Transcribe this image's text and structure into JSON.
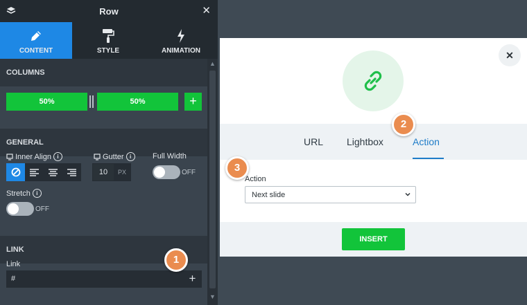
{
  "panel": {
    "title": "Row",
    "close_glyph": "✕",
    "tabs": [
      {
        "label": "CONTENT",
        "icon": "pencil-icon",
        "active": true
      },
      {
        "label": "STYLE",
        "icon": "paint-roller-icon",
        "active": false
      },
      {
        "label": "ANIMATION",
        "icon": "lightning-icon",
        "active": false
      }
    ],
    "sections": {
      "columns": "COLUMNS",
      "general": "GENERAL",
      "link": "LINK"
    },
    "columns": {
      "left": "50%",
      "right": "50%",
      "add": "+"
    },
    "general": {
      "inner_align_label": "Inner Align",
      "gutter_label": "Gutter",
      "gutter_value": "10",
      "gutter_unit": "PX",
      "full_width_label": "Full Width",
      "full_width_state": "OFF",
      "stretch_label": "Stretch",
      "stretch_state": "OFF"
    },
    "link": {
      "label": "Link",
      "value": "#",
      "add": "+"
    }
  },
  "steps": [
    "1",
    "2",
    "3"
  ],
  "modal": {
    "close_glyph": "✕",
    "tabs": [
      {
        "label": "URL",
        "active": false
      },
      {
        "label": "Lightbox",
        "active": false
      },
      {
        "label": "Action",
        "active": true
      }
    ],
    "action_label": "Action",
    "action_value": "Next slide",
    "insert_label": "INSERT"
  },
  "colors": {
    "accent_blue": "#1e88e5",
    "green": "#12c43a",
    "step_orange": "#ea8c4f",
    "panel_dark": "#232a30"
  }
}
